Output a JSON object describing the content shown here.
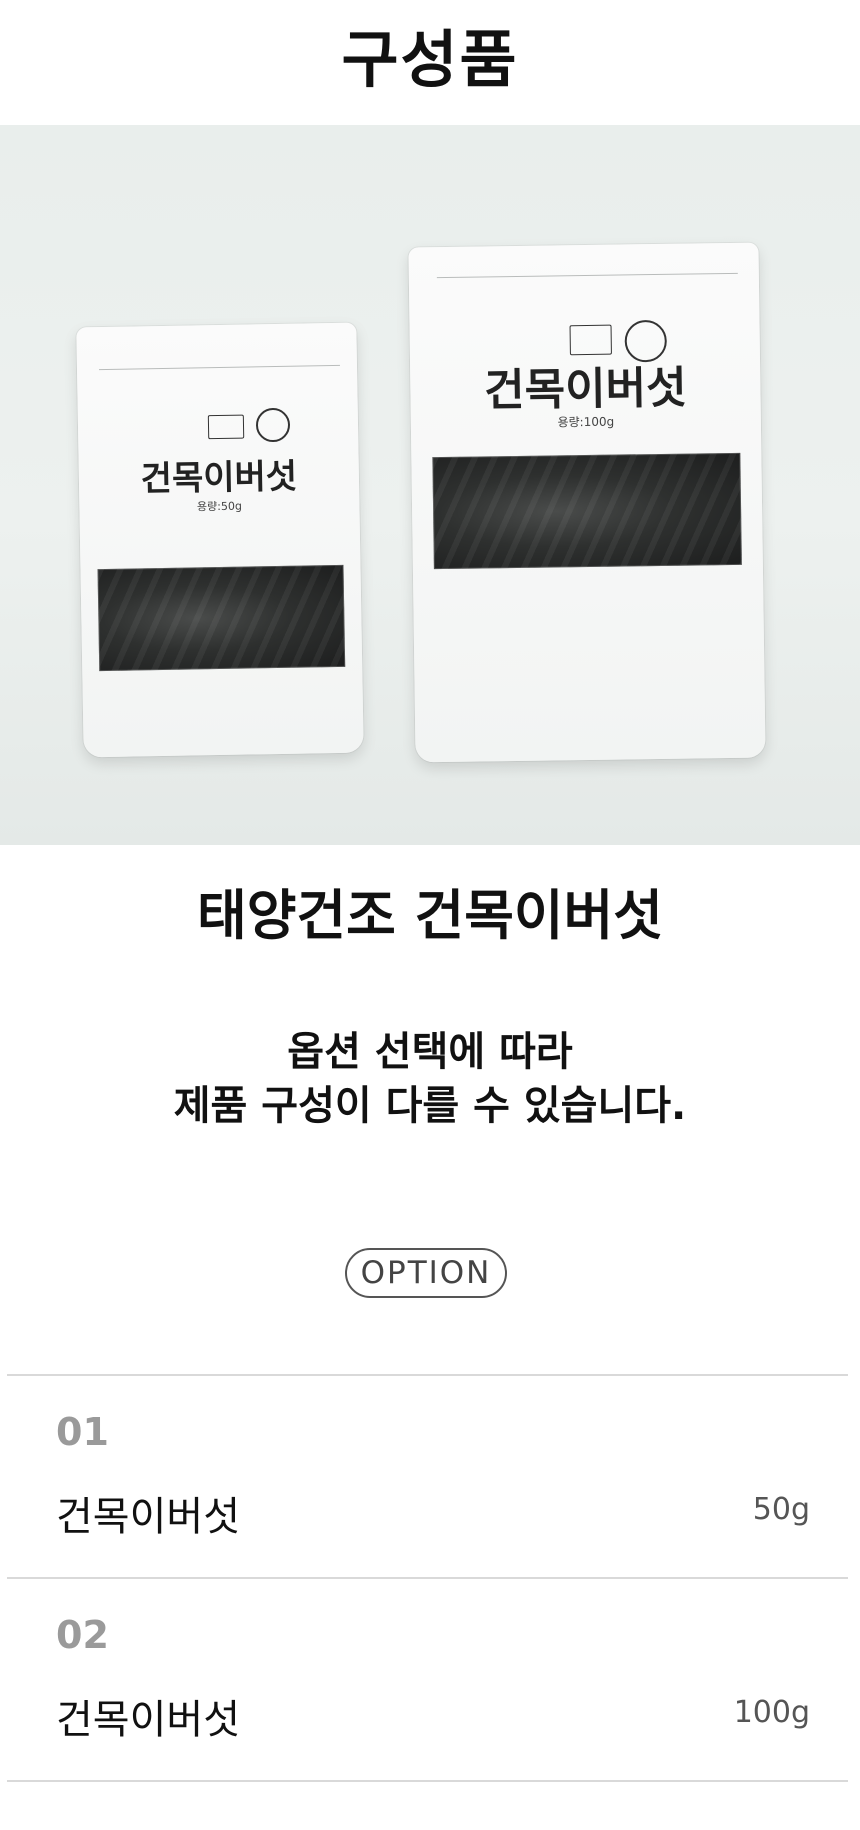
{
  "page": {
    "title": "구성품"
  },
  "product": {
    "name": "태양건조 건목이버섯",
    "notice_line1": "옵션 선택에 따라",
    "notice_line2": "제품 구성이 다를 수 있습니다."
  },
  "photo": {
    "small_bag_label": "건목이버섯",
    "small_bag_weight": "용량:50g",
    "large_bag_label": "건목이버섯",
    "large_bag_weight": "용량:100g"
  },
  "option": {
    "label": "OPTION",
    "items": [
      {
        "number": "01",
        "name": "건목이버섯",
        "amount": "50g"
      },
      {
        "number": "02",
        "name": "건목이버섯",
        "amount": "100g"
      }
    ]
  }
}
